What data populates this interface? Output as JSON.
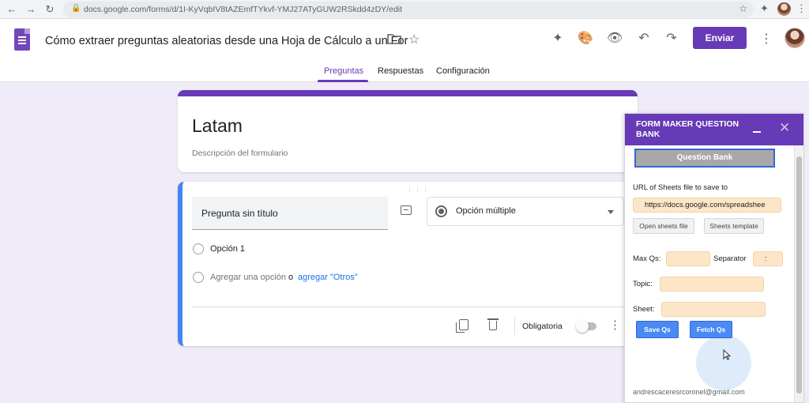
{
  "browser": {
    "url": "docs.google.com/forms/d/1I-KyVqbIV8tAZEmfTYkvf-YMJ27ATyGUW2RSkdd4zDY/edit"
  },
  "header": {
    "doc_title": "Cómo extraer preguntas aleatorias desde una Hoja de Cálculo a un For",
    "send_label": "Enviar",
    "tabs": [
      {
        "label": "Preguntas",
        "active": true
      },
      {
        "label": "Respuestas",
        "active": false
      },
      {
        "label": "Configuración",
        "active": false
      }
    ]
  },
  "form": {
    "title": "Latam",
    "description": "Descripción del formulario"
  },
  "question": {
    "title": "Pregunta sin título",
    "type": "Opción múltiple",
    "option_1": "Opción 1",
    "add_option": "Agregar una opción",
    "or_text": "o",
    "add_other": "agregar \"Otros\"",
    "required_label": "Obligatoria"
  },
  "addon": {
    "title": "FORM MAKER QUESTION BANK",
    "question_bank_label": "Question Bank",
    "url_label": "URL of Sheets file to save to",
    "url_value": "https://docs.google.com/spreadshee",
    "open_sheets_label": "Open sheets file",
    "sheets_template_label": "Sheets template",
    "max_qs_label": "Max Qs:",
    "separator_label": "Separator",
    "separator_value": ":",
    "topic_label": "Topic:",
    "sheet_label": "Sheet:",
    "save_label": "Save Qs",
    "fetch_label": "Fetch Qs",
    "footer_email": "andrescaceresrcoronel@gmail.com"
  },
  "colors": {
    "accent": "#673ab7",
    "link": "#1a73e8",
    "question_border": "#4285f4"
  }
}
